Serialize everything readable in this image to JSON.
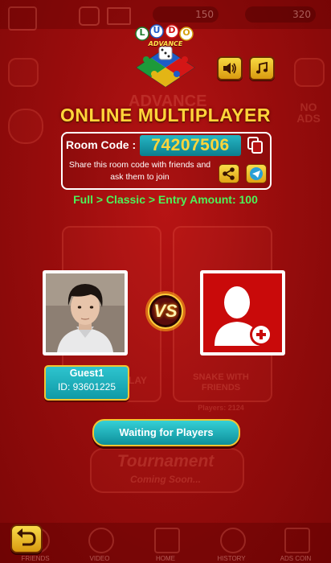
{
  "colors": {
    "background": "#9a0d0d",
    "title": "#ffd53a",
    "accent_teal": "#1aa5b3",
    "entry_green": "#4cf25a",
    "button_gold": "#f4c430"
  },
  "background": {
    "coins": "150",
    "gems": "320",
    "brand": "ADVANCE",
    "no_ads": "NO\nADS",
    "tile_left_caption": "PLAY",
    "tile_right_caption": "SNAKE WITH\nFRIENDS",
    "tile_right_sub": "Players: 2124",
    "tournament": "Tournament",
    "coming_soon": "Coming Soon...",
    "nav": [
      "FRIENDS",
      "VIDEO",
      "HOME",
      "HISTORY",
      "ADS COIN"
    ]
  },
  "logo": {
    "letters": [
      "L",
      "U",
      "D",
      "O"
    ],
    "subtitle": "ADVANCE"
  },
  "header": {
    "sound_icon": "speaker-icon",
    "music_icon": "music-note-icon"
  },
  "page": {
    "title": "ONLINE MULTIPLAYER"
  },
  "room": {
    "label": "Room Code :",
    "code": "74207506",
    "share_text": "Share this room code with friends and ask them to join",
    "copy_icon": "copy-icon",
    "share_icon": "share-icon",
    "telegram_icon": "telegram-icon"
  },
  "entry": {
    "text": "Full > Classic > Entry Amount: 100"
  },
  "player": {
    "name": "Guest1",
    "id_text": "ID: 93601225"
  },
  "versus": {
    "label": "VS"
  },
  "opponent": {
    "icon": "add-user-icon"
  },
  "actions": {
    "waiting_label": "Waiting for Players",
    "back_icon": "back-arrow-icon"
  }
}
